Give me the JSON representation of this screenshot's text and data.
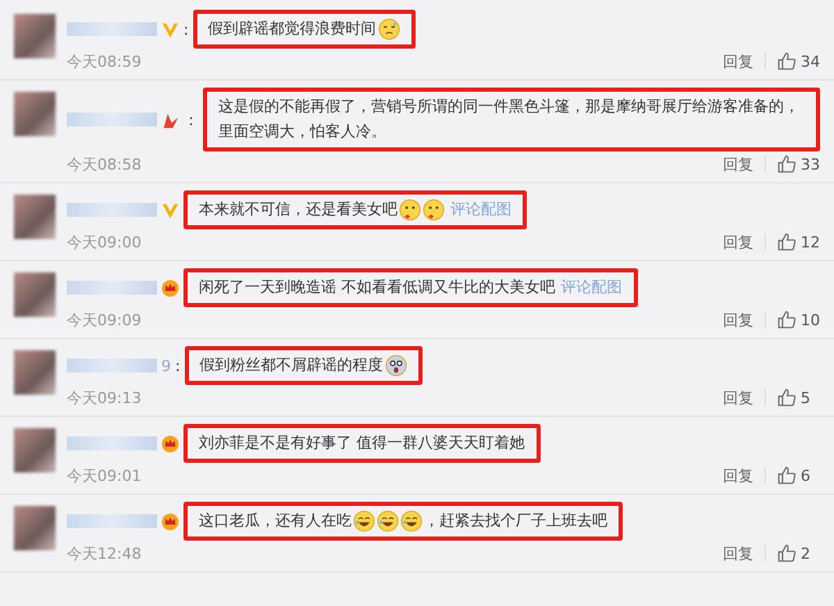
{
  "comments": [
    {
      "badge": {
        "kind": "v"
      },
      "separator": ":",
      "segments": [
        {
          "kind": "text",
          "text": "假到辟谣都觉得浪费时间"
        },
        {
          "kind": "sweat"
        }
      ],
      "time": "今天08:59",
      "reply": "回复",
      "likes": "34",
      "highlighted": true
    },
    {
      "badge": {
        "kind": "star"
      },
      "separator": "：",
      "segments": [
        {
          "kind": "text",
          "text": "这是假的不能再假了，营销号所谓的同一件黑色斗篷，那是摩纳哥展厅给游客准备的，里面空调大，怕客人冷。"
        }
      ],
      "time": "今天08:58",
      "reply": "回复",
      "likes": "33",
      "highlighted": true
    },
    {
      "badge": {
        "kind": "v"
      },
      "segments": [
        {
          "kind": "text",
          "text": "本来就不可信，还是看美女吧"
        },
        {
          "kind": "kiss"
        },
        {
          "kind": "kiss"
        }
      ],
      "link": "评论配图",
      "time": "今天09:00",
      "reply": "回复",
      "likes": "12",
      "highlighted": true
    },
    {
      "badge": {
        "kind": "crown"
      },
      "segments": [
        {
          "kind": "text",
          "text": "闲死了一天到晚造谣 不如看看低调又牛比的大美女吧"
        }
      ],
      "link": "评论配图",
      "time": "今天09:09",
      "reply": "回复",
      "likes": "10",
      "highlighted": true
    },
    {
      "name_tail": "9",
      "separator": ":",
      "segments": [
        {
          "kind": "text",
          "text": "假到粉丝都不屑辟谣的程度"
        },
        {
          "kind": "scared"
        }
      ],
      "time": "今天09:13",
      "reply": "回复",
      "likes": "5",
      "highlighted": true
    },
    {
      "badge": {
        "kind": "crown"
      },
      "segments": [
        {
          "kind": "text",
          "text": "刘亦菲是不是有好事了 值得一群八婆天天盯着她"
        }
      ],
      "time": "今天09:01",
      "reply": "回复",
      "likes": "6",
      "highlighted": true
    },
    {
      "badge": {
        "kind": "crown"
      },
      "segments": [
        {
          "kind": "text",
          "text": "这口老瓜，还有人在吃"
        },
        {
          "kind": "laugh"
        },
        {
          "kind": "laugh"
        },
        {
          "kind": "laugh"
        },
        {
          "kind": "text",
          "text": "，赶紧去找个厂子上班去吧"
        }
      ],
      "time": "今天12:48",
      "reply": "回复",
      "likes": "2",
      "highlighted": true
    }
  ]
}
